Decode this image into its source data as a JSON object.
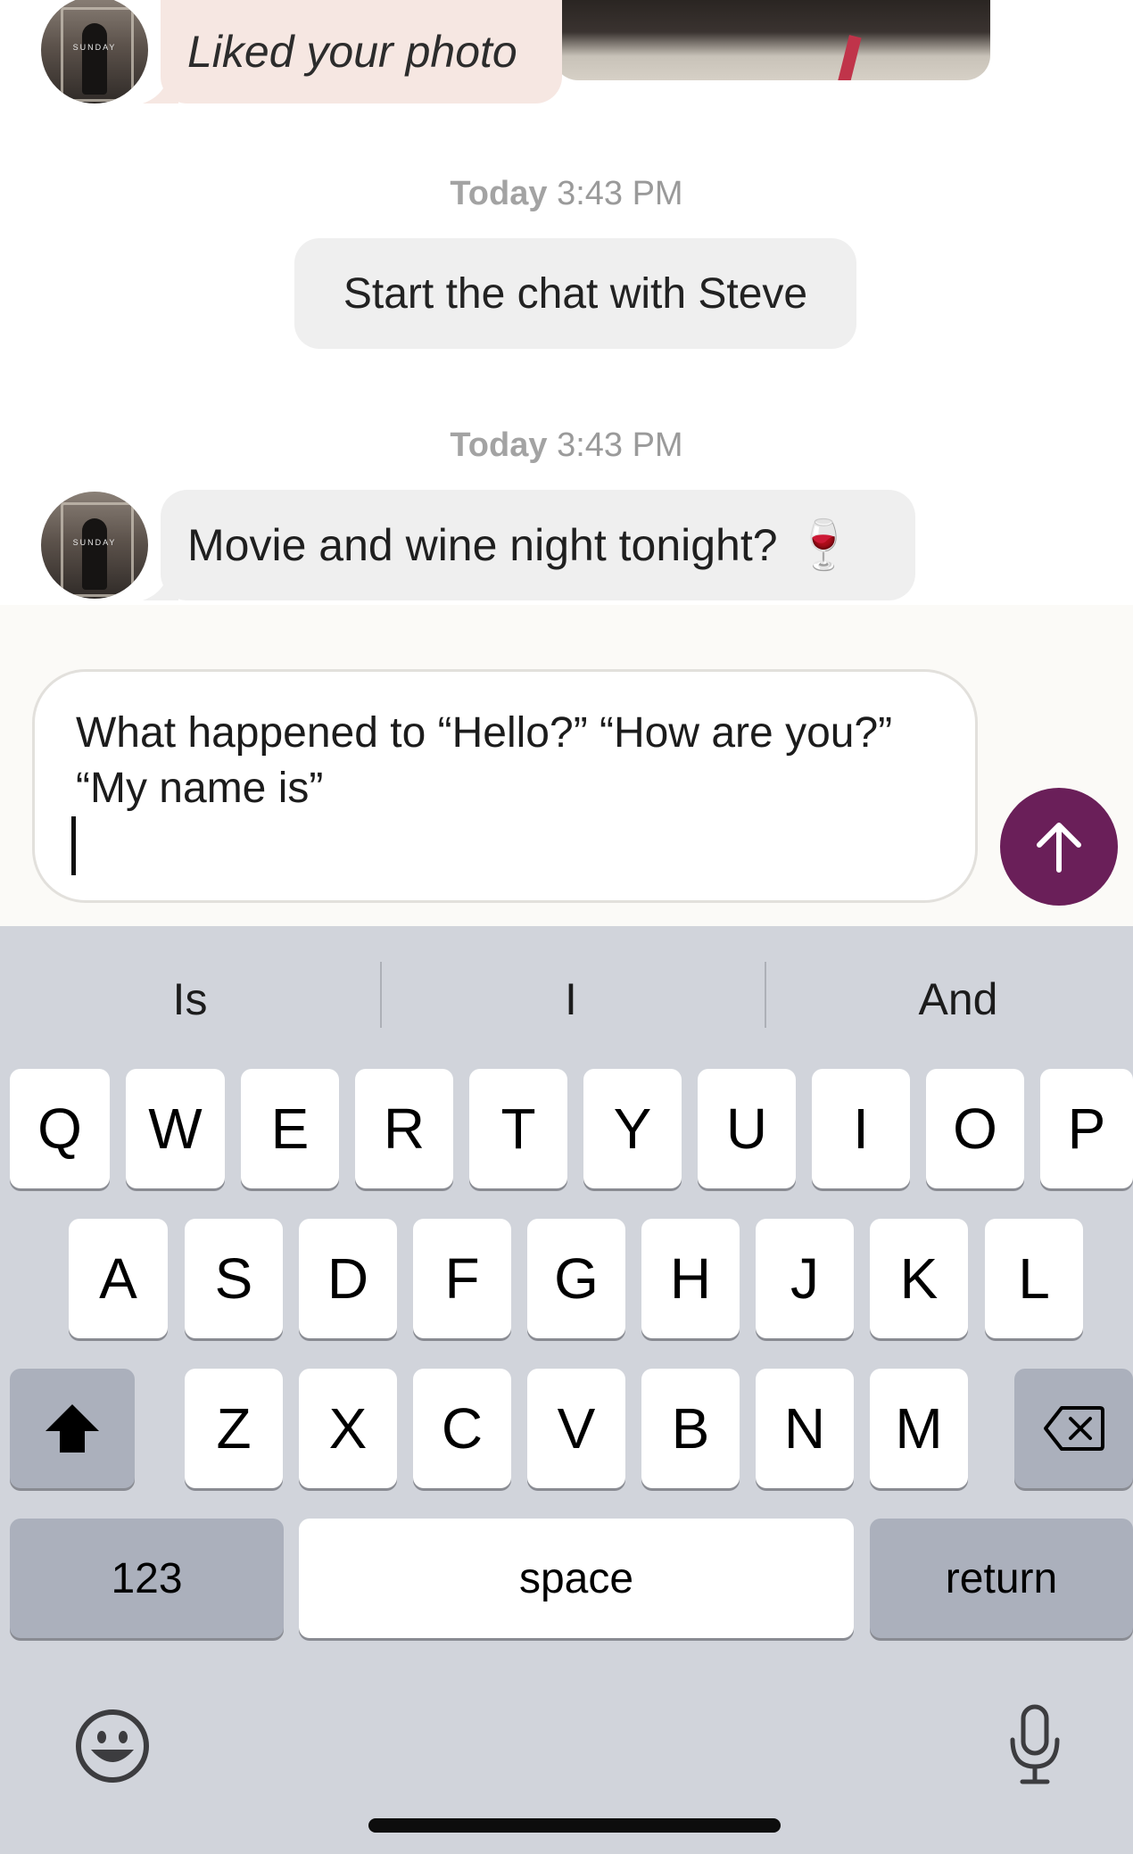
{
  "chat": {
    "liked_text": "Liked your photo",
    "avatar_watermark": "SUNDAY",
    "timestamp_1": {
      "day": "Today",
      "time": "3:43 PM"
    },
    "system_message": "Start the chat with Steve",
    "timestamp_2": {
      "day": "Today",
      "time": "3:43 PM"
    },
    "incoming_message": "Movie and wine night tonight?",
    "incoming_emoji": "🍷"
  },
  "compose": {
    "draft_text": "What happened to “Hello?” “How are you?” “My name is”",
    "send_icon": "arrow-up-icon",
    "send_color": "#6a1f59"
  },
  "keyboard": {
    "suggestions": [
      "Is",
      "I",
      "And"
    ],
    "row1": [
      "Q",
      "W",
      "E",
      "R",
      "T",
      "Y",
      "U",
      "I",
      "O",
      "P"
    ],
    "row2": [
      "A",
      "S",
      "D",
      "F",
      "G",
      "H",
      "J",
      "K",
      "L"
    ],
    "row3": [
      "Z",
      "X",
      "C",
      "V",
      "B",
      "N",
      "M"
    ],
    "numbers_label": "123",
    "space_label": "space",
    "return_label": "return",
    "shift_icon": "shift-icon",
    "delete_icon": "delete-icon",
    "emoji_icon": "emoji-icon",
    "mic_icon": "microphone-icon"
  }
}
